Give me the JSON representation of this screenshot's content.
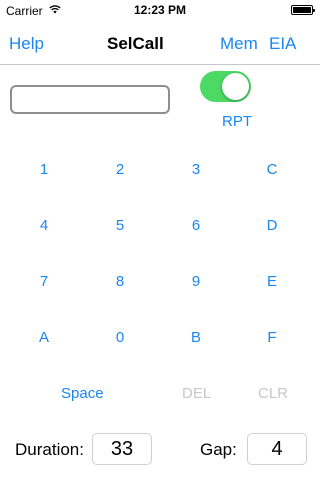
{
  "status_bar": {
    "carrier": "Carrier",
    "wifi_icon": "wifi-icon",
    "time": "12:23 PM",
    "battery_icon": "battery-icon"
  },
  "nav": {
    "left": "Help",
    "title": "SelCall",
    "right_1": "Mem",
    "right_2": "EIA"
  },
  "call_input": {
    "value": "",
    "placeholder": ""
  },
  "repeat": {
    "label": "RPT",
    "on": true
  },
  "keypad": {
    "rows": [
      [
        "1",
        "2",
        "3",
        "C"
      ],
      [
        "4",
        "5",
        "6",
        "D"
      ],
      [
        "7",
        "8",
        "9",
        "E"
      ],
      [
        "A",
        "0",
        "B",
        "F"
      ]
    ],
    "space": "Space",
    "del": "DEL",
    "clr": "CLR"
  },
  "duration": {
    "label": "Duration:",
    "value": "33"
  },
  "gap": {
    "label": "Gap:",
    "value": "4"
  },
  "colors": {
    "accent": "#1a86f0",
    "toggle_on": "#4cd964",
    "disabled": "#c7c7cc"
  }
}
